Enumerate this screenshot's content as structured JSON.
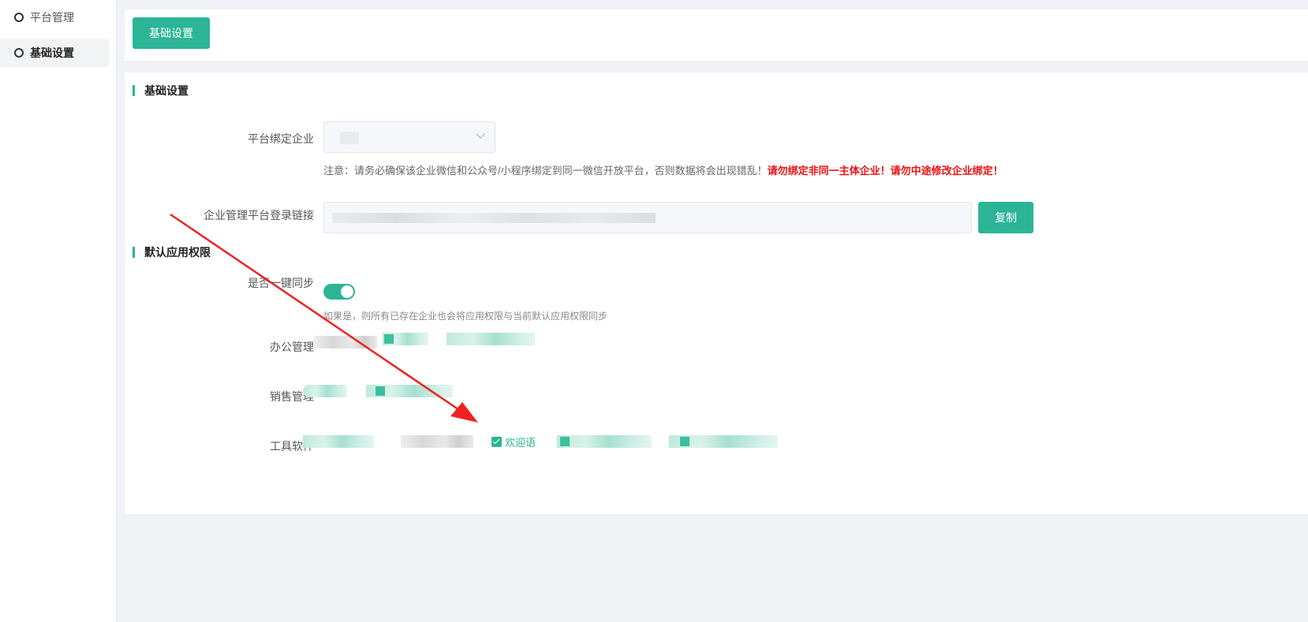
{
  "sidebar": {
    "items": [
      {
        "label": "平台管理",
        "active": false
      },
      {
        "label": "基础设置",
        "active": true
      }
    ]
  },
  "topbar": {
    "button_label": "基础设置"
  },
  "basic": {
    "section_title": "基础设置",
    "enterprise_label": "平台绑定企业",
    "note_prefix": "注意：请务必确保该企业微信和公众号/小程序绑定到同一微信开放平台，否则数据将会出现错乱！",
    "note_warning": "请勿绑定非同一主体企业！请勿中途修改企业绑定！",
    "login_link_label": "企业管理平台登录链接",
    "copy_label": "复制"
  },
  "permissions": {
    "section_title": "默认应用权限",
    "sync_label": "是否一键同步",
    "sync_enabled": true,
    "sync_hint": "如果是，则所有已存在企业也会将应用权限与当前默认应用权限同步",
    "office_label": "办公管理",
    "sales_label": "销售管理",
    "tools_label": "工具软件",
    "welcome_label": "欢迎语"
  },
  "colors": {
    "accent": "#2bb596",
    "warning": "#ee1111",
    "annotation": "#ee2222"
  }
}
